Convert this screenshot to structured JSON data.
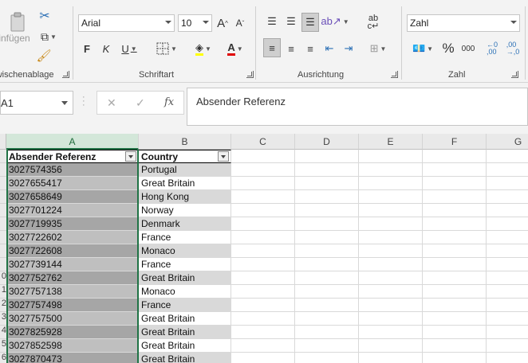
{
  "ribbon": {
    "clipboard": {
      "label": "Zwischenablage",
      "paste_label": "Einfügen"
    },
    "font": {
      "label": "Schriftart",
      "font_name": "Arial",
      "font_size": "10",
      "bold": "F",
      "italic": "K",
      "underline": "U",
      "grow": "A",
      "shrink": "A"
    },
    "alignment": {
      "label": "Ausrichtung"
    },
    "number": {
      "label": "Zahl",
      "format": "Zahl",
      "percent": "%",
      "thousands": "000"
    }
  },
  "formula_bar": {
    "name_box": "A1",
    "fx": "fx",
    "content": "Absender Referenz"
  },
  "grid": {
    "columns": [
      "A",
      "B",
      "C",
      "D",
      "E",
      "F",
      "G"
    ],
    "headers": [
      "Absender Referenz",
      "Country"
    ],
    "row_numbers": [
      "",
      "",
      "",
      "",
      "",
      "",
      "",
      "",
      "",
      "0",
      "1",
      "2",
      "3",
      "4",
      "5",
      "6"
    ],
    "rows": [
      [
        "3027574356",
        "Portugal"
      ],
      [
        "3027655417",
        "Great Britain"
      ],
      [
        "3027658649",
        "Hong Kong"
      ],
      [
        "3027701224",
        "Norway"
      ],
      [
        "3027719935",
        "Denmark"
      ],
      [
        "3027722602",
        "France"
      ],
      [
        "3027722608",
        "Monaco"
      ],
      [
        "3027739144",
        "France"
      ],
      [
        "3027752762",
        "Great Britain"
      ],
      [
        "3027757138",
        "Monaco"
      ],
      [
        "3027757498",
        "France"
      ],
      [
        "3027757500",
        "Great Britain"
      ],
      [
        "3027825928",
        "Great Britain"
      ],
      [
        "3027852598",
        "Great Britain"
      ],
      [
        "3027870473",
        "Great Britain"
      ]
    ]
  },
  "colors": {
    "accent": "#217346",
    "band_dark_a": "#a6a6a6",
    "band_light_a": "#bfbfbf",
    "band_b": "#d9d9d9"
  }
}
